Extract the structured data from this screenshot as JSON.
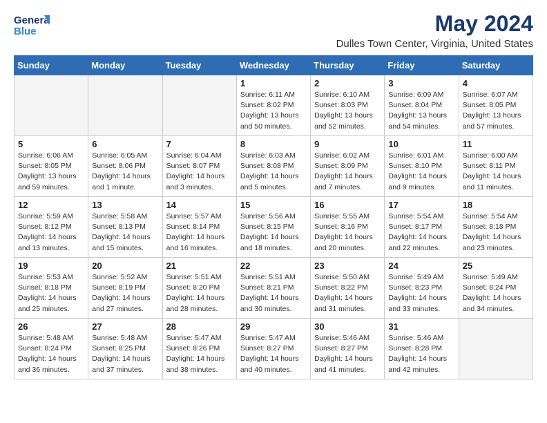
{
  "header": {
    "logo_line1": "General",
    "logo_line2": "Blue",
    "month_title": "May 2024",
    "location": "Dulles Town Center, Virginia, United States"
  },
  "weekdays": [
    "Sunday",
    "Monday",
    "Tuesday",
    "Wednesday",
    "Thursday",
    "Friday",
    "Saturday"
  ],
  "weeks": [
    [
      {
        "day": "",
        "info": ""
      },
      {
        "day": "",
        "info": ""
      },
      {
        "day": "",
        "info": ""
      },
      {
        "day": "1",
        "info": "Sunrise: 6:11 AM\nSunset: 8:02 PM\nDaylight: 13 hours\nand 50 minutes."
      },
      {
        "day": "2",
        "info": "Sunrise: 6:10 AM\nSunset: 8:03 PM\nDaylight: 13 hours\nand 52 minutes."
      },
      {
        "day": "3",
        "info": "Sunrise: 6:09 AM\nSunset: 8:04 PM\nDaylight: 13 hours\nand 54 minutes."
      },
      {
        "day": "4",
        "info": "Sunrise: 6:07 AM\nSunset: 8:05 PM\nDaylight: 13 hours\nand 57 minutes."
      }
    ],
    [
      {
        "day": "5",
        "info": "Sunrise: 6:06 AM\nSunset: 8:05 PM\nDaylight: 13 hours\nand 59 minutes."
      },
      {
        "day": "6",
        "info": "Sunrise: 6:05 AM\nSunset: 8:06 PM\nDaylight: 14 hours\nand 1 minute."
      },
      {
        "day": "7",
        "info": "Sunrise: 6:04 AM\nSunset: 8:07 PM\nDaylight: 14 hours\nand 3 minutes."
      },
      {
        "day": "8",
        "info": "Sunrise: 6:03 AM\nSunset: 8:08 PM\nDaylight: 14 hours\nand 5 minutes."
      },
      {
        "day": "9",
        "info": "Sunrise: 6:02 AM\nSunset: 8:09 PM\nDaylight: 14 hours\nand 7 minutes."
      },
      {
        "day": "10",
        "info": "Sunrise: 6:01 AM\nSunset: 8:10 PM\nDaylight: 14 hours\nand 9 minutes."
      },
      {
        "day": "11",
        "info": "Sunrise: 6:00 AM\nSunset: 8:11 PM\nDaylight: 14 hours\nand 11 minutes."
      }
    ],
    [
      {
        "day": "12",
        "info": "Sunrise: 5:59 AM\nSunset: 8:12 PM\nDaylight: 14 hours\nand 13 minutes."
      },
      {
        "day": "13",
        "info": "Sunrise: 5:58 AM\nSunset: 8:13 PM\nDaylight: 14 hours\nand 15 minutes."
      },
      {
        "day": "14",
        "info": "Sunrise: 5:57 AM\nSunset: 8:14 PM\nDaylight: 14 hours\nand 16 minutes."
      },
      {
        "day": "15",
        "info": "Sunrise: 5:56 AM\nSunset: 8:15 PM\nDaylight: 14 hours\nand 18 minutes."
      },
      {
        "day": "16",
        "info": "Sunrise: 5:55 AM\nSunset: 8:16 PM\nDaylight: 14 hours\nand 20 minutes."
      },
      {
        "day": "17",
        "info": "Sunrise: 5:54 AM\nSunset: 8:17 PM\nDaylight: 14 hours\nand 22 minutes."
      },
      {
        "day": "18",
        "info": "Sunrise: 5:54 AM\nSunset: 8:18 PM\nDaylight: 14 hours\nand 23 minutes."
      }
    ],
    [
      {
        "day": "19",
        "info": "Sunrise: 5:53 AM\nSunset: 8:18 PM\nDaylight: 14 hours\nand 25 minutes."
      },
      {
        "day": "20",
        "info": "Sunrise: 5:52 AM\nSunset: 8:19 PM\nDaylight: 14 hours\nand 27 minutes."
      },
      {
        "day": "21",
        "info": "Sunrise: 5:51 AM\nSunset: 8:20 PM\nDaylight: 14 hours\nand 28 minutes."
      },
      {
        "day": "22",
        "info": "Sunrise: 5:51 AM\nSunset: 8:21 PM\nDaylight: 14 hours\nand 30 minutes."
      },
      {
        "day": "23",
        "info": "Sunrise: 5:50 AM\nSunset: 8:22 PM\nDaylight: 14 hours\nand 31 minutes."
      },
      {
        "day": "24",
        "info": "Sunrise: 5:49 AM\nSunset: 8:23 PM\nDaylight: 14 hours\nand 33 minutes."
      },
      {
        "day": "25",
        "info": "Sunrise: 5:49 AM\nSunset: 8:24 PM\nDaylight: 14 hours\nand 34 minutes."
      }
    ],
    [
      {
        "day": "26",
        "info": "Sunrise: 5:48 AM\nSunset: 8:24 PM\nDaylight: 14 hours\nand 36 minutes."
      },
      {
        "day": "27",
        "info": "Sunrise: 5:48 AM\nSunset: 8:25 PM\nDaylight: 14 hours\nand 37 minutes."
      },
      {
        "day": "28",
        "info": "Sunrise: 5:47 AM\nSunset: 8:26 PM\nDaylight: 14 hours\nand 38 minutes."
      },
      {
        "day": "29",
        "info": "Sunrise: 5:47 AM\nSunset: 8:27 PM\nDaylight: 14 hours\nand 40 minutes."
      },
      {
        "day": "30",
        "info": "Sunrise: 5:46 AM\nSunset: 8:27 PM\nDaylight: 14 hours\nand 41 minutes."
      },
      {
        "day": "31",
        "info": "Sunrise: 5:46 AM\nSunset: 8:28 PM\nDaylight: 14 hours\nand 42 minutes."
      },
      {
        "day": "",
        "info": ""
      }
    ]
  ]
}
